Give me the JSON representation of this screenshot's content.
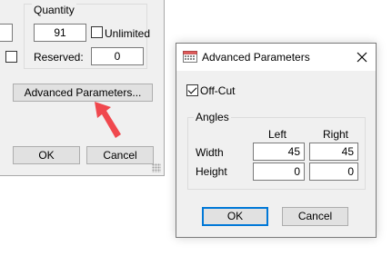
{
  "parent_dialog": {
    "quantity_group_title": "Quantity",
    "quantity_value": "91",
    "unlimited_label": "Unlimited",
    "unlimited_checked": false,
    "reserved_label": "Reserved:",
    "reserved_value": "0",
    "advanced_button_label": "Advanced Parameters...",
    "ok_label": "OK",
    "cancel_label": "Cancel"
  },
  "advanced_dialog": {
    "title": "Advanced Parameters",
    "offcut_label": "Off-Cut",
    "offcut_checked": true,
    "angles_group_title": "Angles",
    "col_left": "Left",
    "col_right": "Right",
    "rows": [
      {
        "label": "Width",
        "left": "45",
        "right": "45"
      },
      {
        "label": "Height",
        "left": "0",
        "right": "0"
      }
    ],
    "ok_label": "OK",
    "cancel_label": "Cancel"
  },
  "colors": {
    "accent": "#0078d7",
    "annotation_arrow": "#f0484e",
    "dialog_bg": "#f0f0f0"
  },
  "icons": [
    "title-window-icon",
    "close-icon",
    "annotation-arrow",
    "resize-grip"
  ]
}
